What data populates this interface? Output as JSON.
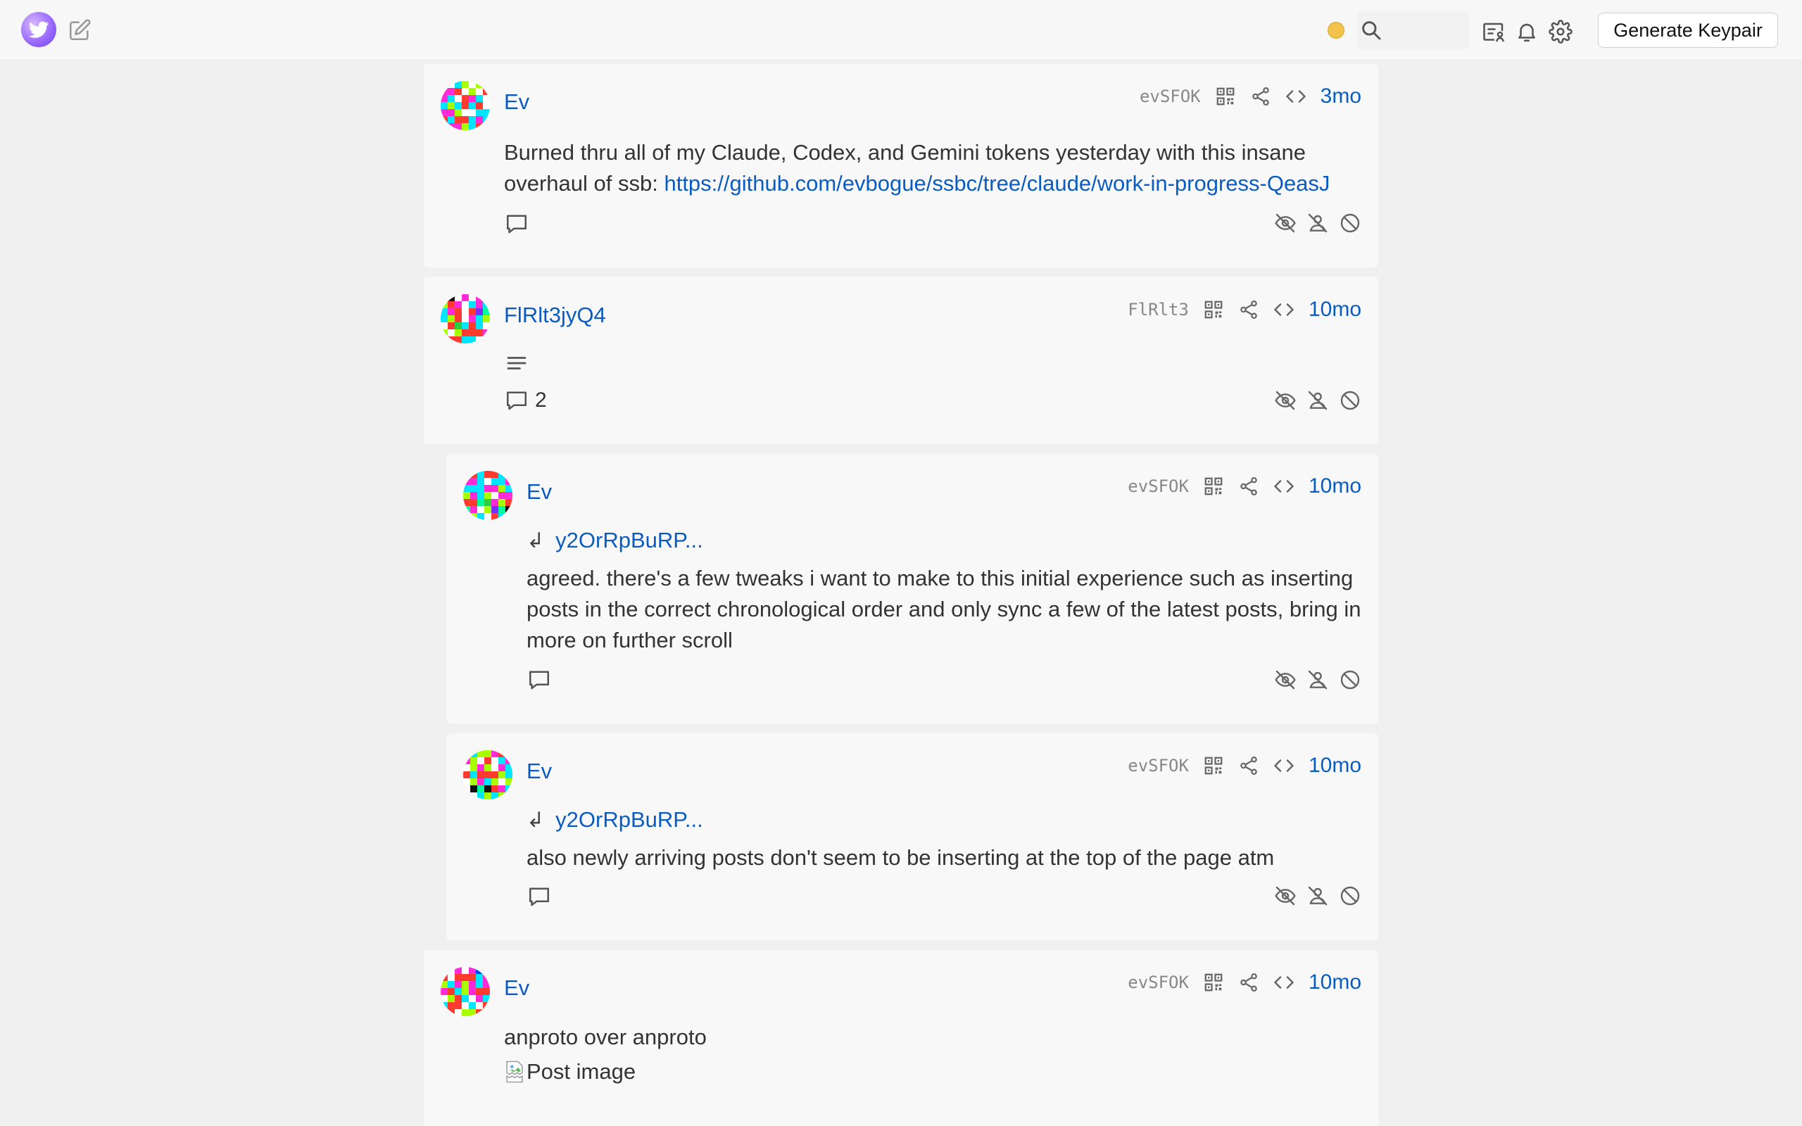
{
  "topbar": {
    "logo_icon": "bird-logo-icon",
    "compose_icon": "compose-icon",
    "status_color": "#f2c34a",
    "search": {
      "value": "",
      "placeholder": ""
    },
    "generate_button": "Generate Keypair"
  },
  "accent_color": "#0a5cc2",
  "posts": [
    {
      "author": "Ev",
      "short_id": "evSFOK",
      "age": "3mo",
      "text_before_link": "Burned thru all of my Claude, Codex, and Gemini tokens yesterday with this insane overhaul of ssb: ",
      "link": "https://github.com/evbogue/ssbc/tree/claude/work-in-progress-QeasJ",
      "comments": ""
    },
    {
      "author": "FlRlt3jyQ4",
      "short_id": "FlRlt3",
      "age": "10mo",
      "comments": "2"
    },
    {
      "author": "Ev",
      "short_id": "evSFOK",
      "age": "10mo",
      "reply_arrow": "↲",
      "reply_to": "y2OrRpBuRP...",
      "text": "agreed. there's a few tweaks i want to make to this initial experience such as inserting posts in the correct chronological order and only sync a few of the latest posts, bring in more on further scroll",
      "comments": ""
    },
    {
      "author": "Ev",
      "short_id": "evSFOK",
      "age": "10mo",
      "reply_arrow": "↲",
      "reply_to": "y2OrRpBuRP...",
      "text": "also newly arriving posts don't seem to be inserting at the top of the page atm",
      "comments": ""
    },
    {
      "author": "Ev",
      "short_id": "evSFOK",
      "age": "10mo",
      "text": "anproto over anproto",
      "image_alt": "Post image"
    }
  ]
}
